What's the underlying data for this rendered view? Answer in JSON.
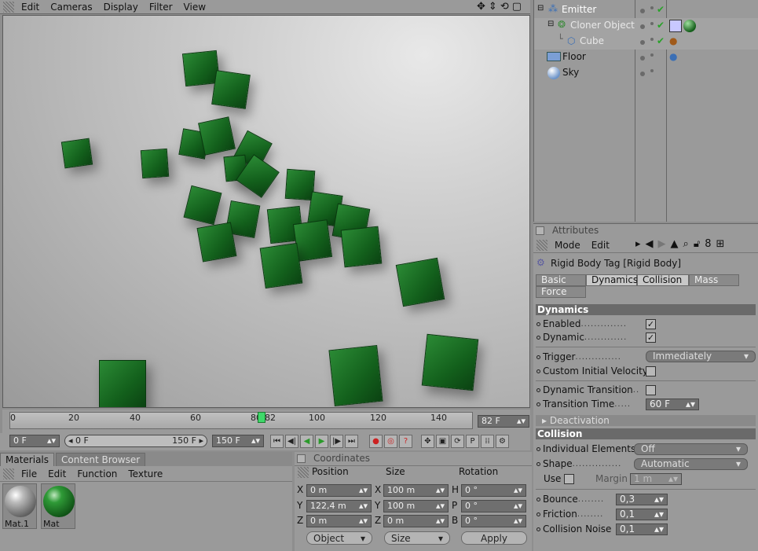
{
  "viewport_menu": [
    "Edit",
    "Cameras",
    "Display",
    "Filter",
    "View"
  ],
  "timeline": {
    "ticks": [
      "0",
      "20",
      "40",
      "60",
      "80",
      "82",
      "100",
      "120",
      "140"
    ],
    "current_frame": "82 F",
    "start": "0 F",
    "range_start": "0 F",
    "range_end": "150 F",
    "end": "150 F"
  },
  "materials": {
    "tabs": [
      "Materials",
      "Content Browser"
    ],
    "menu": [
      "File",
      "Edit",
      "Function",
      "Texture"
    ],
    "items": [
      {
        "name": "Mat.1",
        "color": "#8d8d8d"
      },
      {
        "name": "Mat",
        "color": "#1f6e25"
      }
    ]
  },
  "coordinates": {
    "title": "Coordinates",
    "headers": [
      "Position",
      "Size",
      "Rotation"
    ],
    "rows": [
      {
        "p_label": "X",
        "p_val": "0 m",
        "s_label": "X",
        "s_val": "100 m",
        "r_label": "H",
        "r_val": "0 °"
      },
      {
        "p_label": "Y",
        "p_val": "122,4 m",
        "s_label": "Y",
        "s_val": "100 m",
        "r_label": "P",
        "r_val": "0 °"
      },
      {
        "p_label": "Z",
        "p_val": "0 m",
        "s_label": "Z",
        "s_val": "0 m",
        "r_label": "B",
        "r_val": "0 °"
      }
    ],
    "mode": "Object",
    "size_mode": "Size",
    "apply": "Apply"
  },
  "objects": [
    {
      "name": "Emitter"
    },
    {
      "name": "Cloner Object"
    },
    {
      "name": "Cube"
    },
    {
      "name": "Floor"
    },
    {
      "name": "Sky"
    }
  ],
  "attributes": {
    "title": "Attributes",
    "menu": [
      "Mode",
      "Edit"
    ],
    "object_title": "Rigid Body Tag [Rigid Body]",
    "tabs": [
      "Basic",
      "Dynamics",
      "Collision",
      "Mass",
      "Force"
    ],
    "dynamics_header": "Dynamics",
    "enabled": "Enabled",
    "dynamic": "Dynamic",
    "trigger": "Trigger",
    "trigger_val": "Immediately",
    "civ": "Custom Initial Velocity",
    "dyn_transition": "Dynamic Transition",
    "transition_time": "Transition Time",
    "transition_time_val": "60 F",
    "deactivation": "Deactivation",
    "collision_header": "Collision",
    "individual": "Individual Elements",
    "individual_val": "Off",
    "shape": "Shape",
    "shape_val": "Automatic",
    "use": "Use",
    "margin": "Margin",
    "margin_val": "1 m",
    "bounce": "Bounce",
    "bounce_val": "0,3",
    "friction": "Friction",
    "friction_val": "0,1",
    "noise": "Collision Noise",
    "noise_val": "0,1"
  }
}
